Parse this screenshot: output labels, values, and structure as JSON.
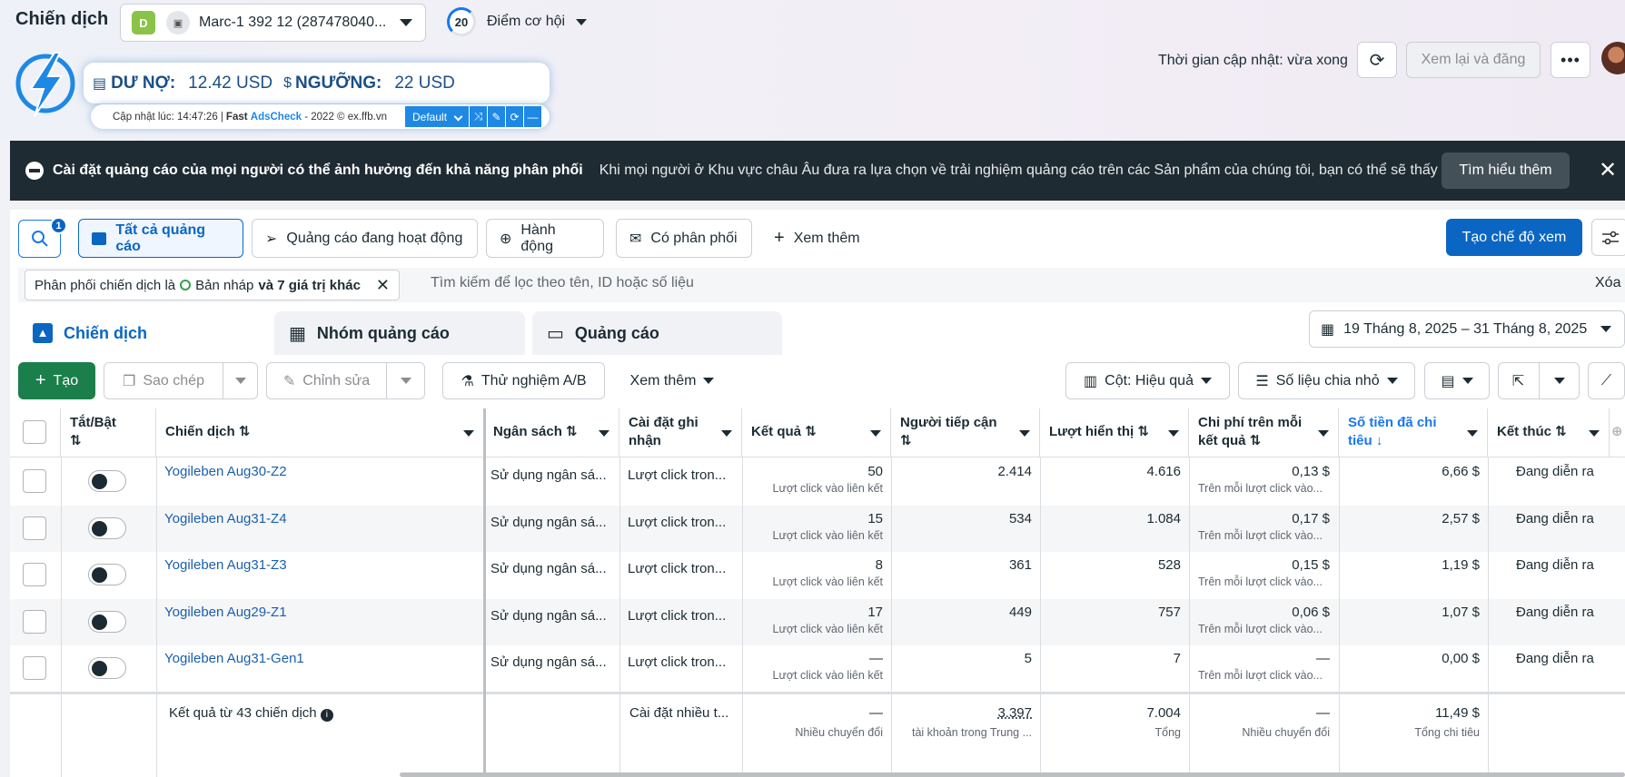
{
  "page": {
    "title": "Chiến dịch"
  },
  "account": {
    "badge": "D",
    "name": "Marc-1 392 12 (287478040..."
  },
  "opportunity": {
    "score": "20",
    "label": "Điểm cơ hội"
  },
  "extension": {
    "debt_label": "DƯ NỢ:",
    "debt_value": "12.42 USD",
    "threshold_label": "NGƯỠNG:",
    "threshold_value": "22 USD",
    "updated": "Cập nhật lúc: 14:47:26 |",
    "brand_fast": "Fast",
    "brand_ads": "AdsCheck",
    "brand_tail": "- 2022 © ex.ffb.vn",
    "select": "Default"
  },
  "header": {
    "update_time": "Thời gian cập nhật: vừa xong",
    "review_publish": "Xem lại và đăng"
  },
  "banner": {
    "title": "Cài đặt quảng cáo của mọi người có thể ảnh hưởng đến khả năng phân phối",
    "body": "Khi mọi người ở Khu vực châu Âu đưa ra lựa chọn về trải nghiệm quảng cáo trên các Sản phẩm của chúng tôi, bạn có thể sẽ thấy tác...",
    "learn_more": "Tìm hiểu thêm"
  },
  "filters": {
    "badge_count": "1",
    "all_ads": "Tất cả quảng cáo",
    "active_ads": "Quảng cáo đang hoạt động",
    "actions": "Hành động",
    "delivering": "Có phân phối",
    "see_more": "Xem thêm",
    "create_view": "Tạo chế độ xem",
    "chip_prefix": "Phân phối chiến dịch là",
    "chip_value": "Bản nháp",
    "chip_suffix": "và 7 giá trị khác",
    "search_placeholder": "Tìm kiếm để lọc theo tên, ID hoặc số liệu",
    "clear": "Xóa"
  },
  "tabs": [
    {
      "label": "Chiến dịch"
    },
    {
      "label": "Nhóm quảng cáo"
    },
    {
      "label": "Quảng cáo"
    }
  ],
  "date_range": "19 Tháng 8, 2025 – 31 Tháng 8, 2025",
  "toolbar": {
    "create": "Tạo",
    "copy": "Sao chép",
    "edit": "Chỉnh sửa",
    "ab_test": "Thử nghiệm A/B",
    "more": "Xem thêm",
    "columns": "Cột: Hiệu quả",
    "breakdown": "Số liệu chia nhỏ"
  },
  "columns": {
    "toggle": "Tắt/Bật",
    "campaign": "Chiến dịch",
    "budget": "Ngân sách",
    "attribution": "Cài đặt ghi nhận",
    "results": "Kết quả",
    "reach": "Người tiếp cận",
    "impressions": "Lượt hiển thị",
    "cpr": "Chi phí trên mỗi kết quả",
    "spent": "Số tiền đã chi tiêu",
    "ends": "Kết thúc"
  },
  "rows": [
    {
      "name": "Yogileben Aug30-Z2",
      "budget": "Sử dụng ngân sá...",
      "attr": "Lượt click tron...",
      "result": "50",
      "result_sub": "Lượt click vào liên kết",
      "reach": "2.414",
      "impr": "4.616",
      "cpr": "0,13 $",
      "cpr_sub": "Trên mỗi lượt click vào...",
      "spent": "6,66 $",
      "ends": "Đang diễn ra"
    },
    {
      "name": "Yogileben Aug31-Z4",
      "budget": "Sử dụng ngân sá...",
      "attr": "Lượt click tron...",
      "result": "15",
      "result_sub": "Lượt click vào liên kết",
      "reach": "534",
      "impr": "1.084",
      "cpr": "0,17 $",
      "cpr_sub": "Trên mỗi lượt click vào...",
      "spent": "2,57 $",
      "ends": "Đang diễn ra"
    },
    {
      "name": "Yogileben Aug31-Z3",
      "budget": "Sử dụng ngân sá...",
      "attr": "Lượt click tron...",
      "result": "8",
      "result_sub": "Lượt click vào liên kết",
      "reach": "361",
      "impr": "528",
      "cpr": "0,15 $",
      "cpr_sub": "Trên mỗi lượt click vào...",
      "spent": "1,19 $",
      "ends": "Đang diễn ra"
    },
    {
      "name": "Yogileben Aug29-Z1",
      "budget": "Sử dụng ngân sá...",
      "attr": "Lượt click tron...",
      "result": "17",
      "result_sub": "Lượt click vào liên kết",
      "reach": "449",
      "impr": "757",
      "cpr": "0,06 $",
      "cpr_sub": "Trên mỗi lượt click vào...",
      "spent": "1,07 $",
      "ends": "Đang diễn ra"
    },
    {
      "name": "Yogileben Aug31-Gen1",
      "budget": "Sử dụng ngân sá...",
      "attr": "Lượt click tron...",
      "result": "—",
      "result_sub": "Lượt click vào liên kết",
      "reach": "5",
      "impr": "7",
      "cpr": "—",
      "cpr_sub": "Trên mỗi lượt click vào...",
      "spent": "0,00 $",
      "ends": "Đang diễn ra"
    }
  ],
  "totals": {
    "label": "Kết quả từ 43 chiến dịch",
    "attr": "Cài đặt nhiều t...",
    "result": "—",
    "result_sub": "Nhiều chuyển đổi",
    "reach": "3.397",
    "reach_sub": "tài khoản trong Trung ...",
    "impr": "7.004",
    "impr_sub": "Tổng",
    "cpr": "—",
    "cpr_sub": "Nhiều chuyển đổi",
    "spent": "11,49 $",
    "spent_sub": "Tổng chi tiêu"
  },
  "colors": {
    "accent": "#0a66c2",
    "green": "#1a7f4b",
    "banner": "#1f2b33"
  }
}
